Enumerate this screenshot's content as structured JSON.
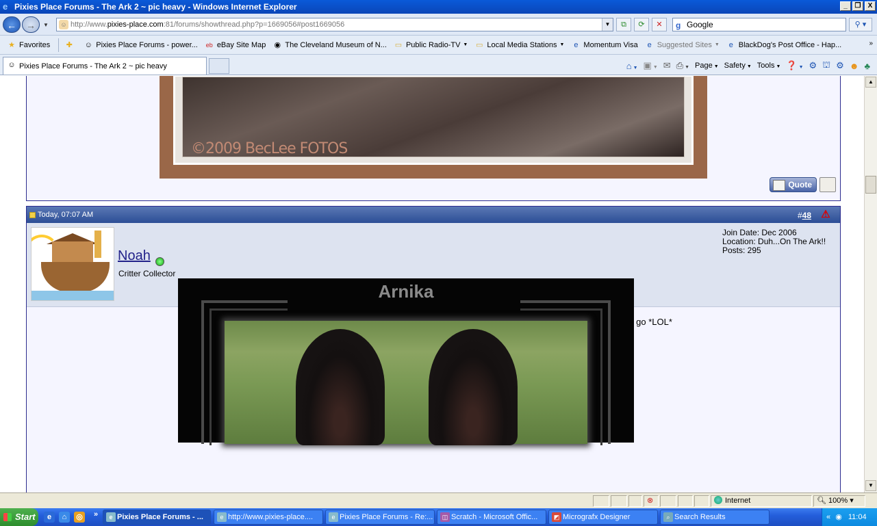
{
  "window": {
    "title": "Pixies Place Forums - The Ark 2 ~ pic heavy - Windows Internet Explorer",
    "min": "_",
    "max": "❐",
    "close": "X"
  },
  "address": {
    "url_prefix": "http://www.",
    "url_host": "pixies-place.com",
    "url_rest": ":81/forums/showthread.php?p=1669056#post1669056"
  },
  "search": {
    "value": "Google"
  },
  "favorites_bar": {
    "favorites_label": "Favorites",
    "items": [
      "Pixies Place Forums - power...",
      "eBay Site Map",
      "The Cleveland Museum of N...",
      "Public Radio-TV",
      "Local Media Stations",
      "Momentum Visa",
      "Suggested Sites",
      "BlackDog's Post Office - Hap..."
    ]
  },
  "tabs": [
    {
      "label": "Pixies Place Forums - The Ark 2 ~ pic heavy"
    }
  ],
  "commands": {
    "page": "Page",
    "safety": "Safety",
    "tools": "Tools"
  },
  "post_prev": {
    "watermark": "©2009 BecLee FOTOS",
    "quote_label": "Quote"
  },
  "post": {
    "date": "Today, 07:07 AM",
    "number_prefix": "#",
    "number": "48",
    "username": "Noah",
    "user_title": "Critter Collector",
    "join_date": "Join Date: Dec 2006",
    "location": "Location: Duh...On The Ark!!",
    "posts": "Posts: 295",
    "message": "Yep Nika is hamming it up again *L* and well its been a while since i've given the camera a workout, so here we go *LOL*",
    "image_title": "Arnika"
  },
  "statusbar": {
    "zone": "Internet",
    "zoom": "100%"
  },
  "taskbar": {
    "start": "Start",
    "tasks": [
      "Pixies Place Forums - ...",
      "http://www.pixies-place....",
      "Pixies Place Forums - Re:...",
      "Scratch - Microsoft Offic...",
      "Micrografx Designer",
      "Search Results"
    ],
    "clock": "11:04"
  }
}
